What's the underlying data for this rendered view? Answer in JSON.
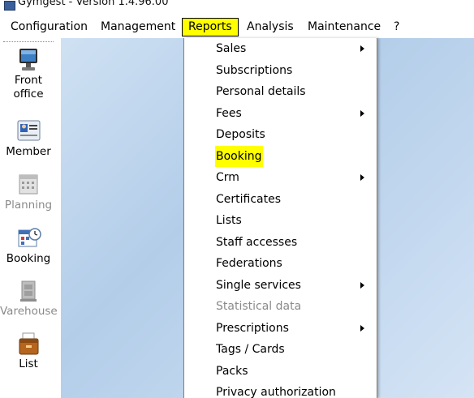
{
  "window": {
    "title": "Gymgest - Version 1.4.96.00"
  },
  "menubar": {
    "items": [
      {
        "label": "Configuration"
      },
      {
        "label": "Management"
      },
      {
        "label": "Reports"
      },
      {
        "label": "Analysis"
      },
      {
        "label": "Maintenance"
      },
      {
        "label": "?"
      }
    ]
  },
  "sidebar": {
    "items": [
      {
        "label_line1": "Front",
        "label_line2": "office",
        "icon": "monitor-icon"
      },
      {
        "label_line1": "Member",
        "icon": "member-card-icon"
      },
      {
        "label_line1": "Planning",
        "icon": "calendar-icon",
        "disabled": true
      },
      {
        "label_line1": "Booking",
        "icon": "booking-calendar-icon"
      },
      {
        "label_line1": "Varehouse",
        "icon": "warehouse-icon",
        "disabled": true
      },
      {
        "label_line1": "List",
        "icon": "list-box-icon"
      }
    ]
  },
  "reports_menu": {
    "items": [
      {
        "label": "Sales",
        "submenu": true
      },
      {
        "label": "Subscriptions"
      },
      {
        "label": "Personal details"
      },
      {
        "label": "Fees",
        "submenu": true
      },
      {
        "label": "Deposits"
      },
      {
        "label": "Booking",
        "highlighted": true
      },
      {
        "label": "Crm",
        "submenu": true
      },
      {
        "label": "Certificates"
      },
      {
        "label": "Lists"
      },
      {
        "label": "Staff accesses"
      },
      {
        "label": "Federations"
      },
      {
        "label": "Single services",
        "submenu": true
      },
      {
        "label": "Statistical data",
        "disabled": true
      },
      {
        "label": "Prescriptions",
        "submenu": true
      },
      {
        "label": "Tags / Cards"
      },
      {
        "label": "Packs"
      },
      {
        "label": "Privacy authorization"
      }
    ]
  },
  "colors": {
    "highlight": "#ffff00",
    "workspace": "#b3cde9",
    "disabled_text": "#8a8a8a"
  }
}
